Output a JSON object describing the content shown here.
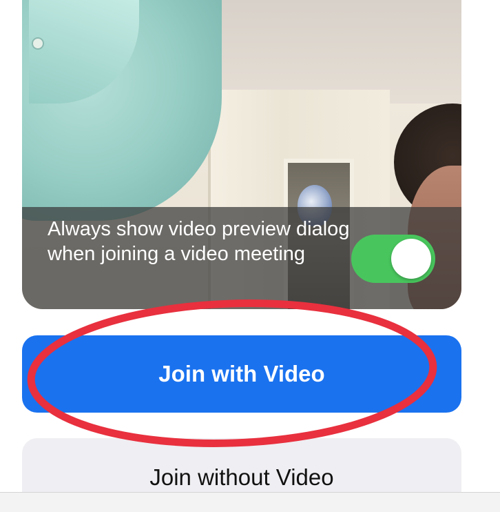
{
  "preview": {
    "toggle_label": "Always show video preview dialog when joining a video meeting",
    "toggle_state": "on"
  },
  "actions": {
    "join_with_video": "Join with Video",
    "join_without_video": "Join without Video"
  },
  "colors": {
    "primary_button": "#1a72ef",
    "toggle_on": "#48c65d",
    "annotation": "#e8303e",
    "secondary_button": "#efeef2"
  }
}
